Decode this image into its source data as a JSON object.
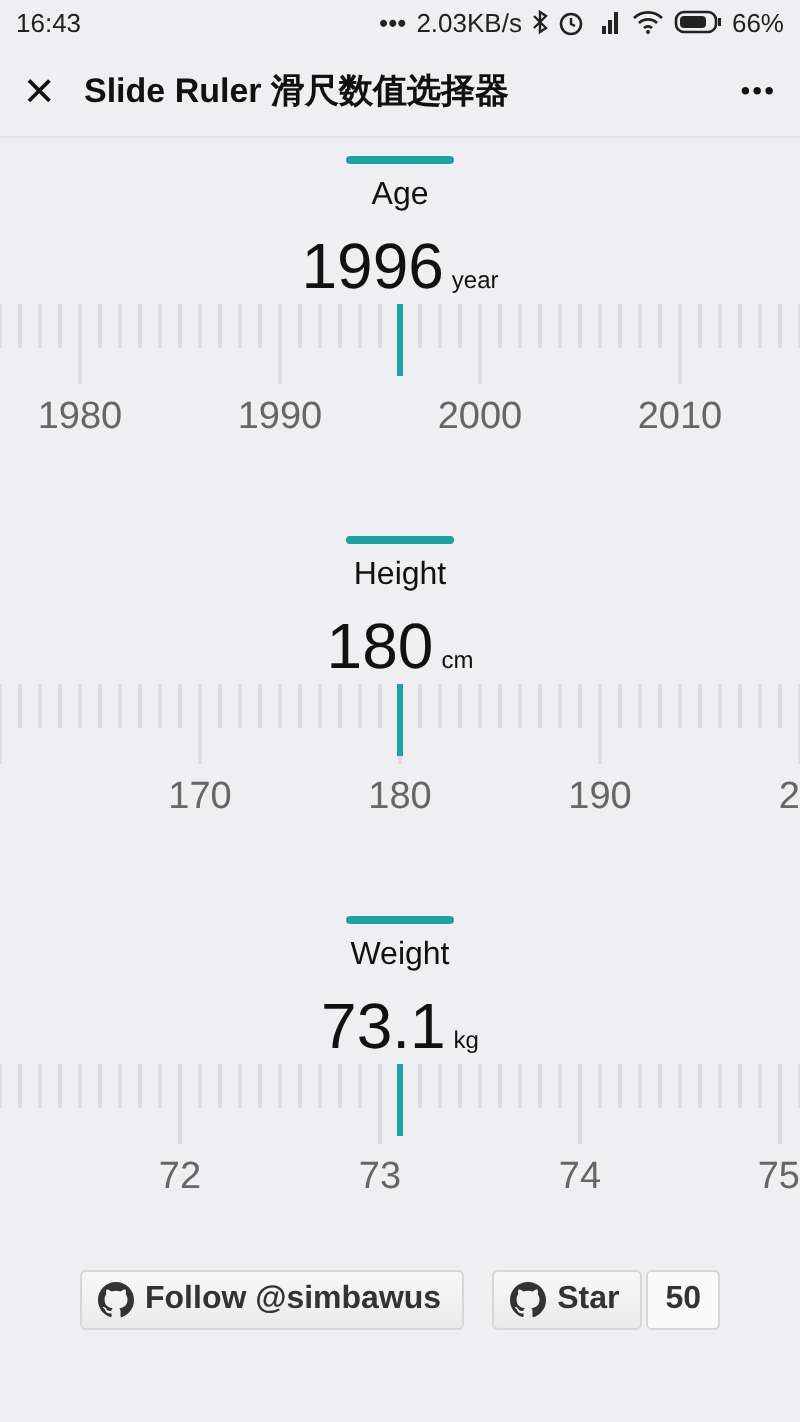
{
  "status_bar": {
    "time": "16:43",
    "dots": "•••",
    "speed": "2.03KB/s",
    "battery": "66%"
  },
  "title_bar": {
    "close": "×",
    "title": "Slide Ruler 滑尺数值选择器",
    "more": "•••"
  },
  "rulers": [
    {
      "label": "Age",
      "value": "1996",
      "unit": "year",
      "labels": [
        "1980",
        "1990",
        "2000",
        "2010"
      ]
    },
    {
      "label": "Height",
      "value": "180",
      "unit": "cm",
      "labels": [
        "170",
        "180",
        "190",
        "2"
      ]
    },
    {
      "label": "Weight",
      "value": "73.1",
      "unit": "kg",
      "labels": [
        "72",
        "73",
        "74",
        "75"
      ]
    }
  ],
  "buttons": [
    {
      "kind": "follow",
      "label": "Follow @simbawus"
    },
    {
      "kind": "star",
      "label": "Star",
      "count": "50"
    }
  ]
}
